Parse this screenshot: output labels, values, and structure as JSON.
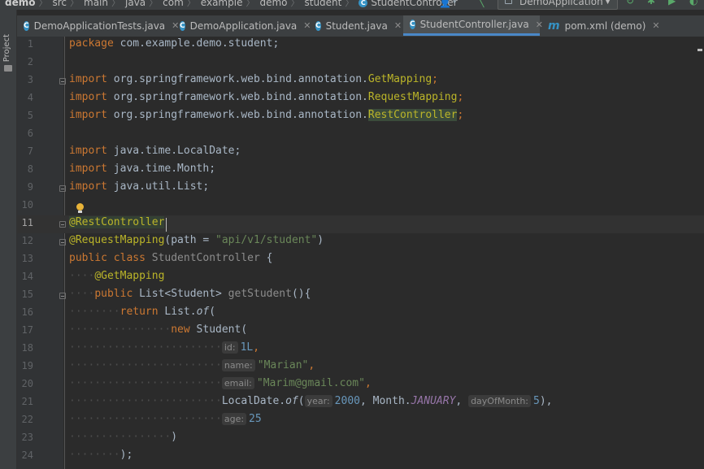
{
  "breadcrumb": {
    "items": [
      "demo",
      "src",
      "main",
      "java",
      "com",
      "example",
      "demo",
      "student",
      "StudentController"
    ]
  },
  "toolbar": {
    "run_config": "DemoApplication"
  },
  "sidebar": {
    "project_label": "Project"
  },
  "tabs": [
    {
      "label": "DemoApplicationTests.java",
      "icon": "class-c-icon"
    },
    {
      "label": "DemoApplication.java",
      "icon": "class-c-icon"
    },
    {
      "label": "Student.java",
      "icon": "class-c-icon"
    },
    {
      "label": "StudentController.java",
      "icon": "class-c-icon",
      "active": true
    },
    {
      "label": "pom.xml (demo)",
      "icon": "maven-m-icon"
    }
  ],
  "editor": {
    "current_line": 11,
    "line_numbers": [
      "1",
      "2",
      "3",
      "4",
      "5",
      "6",
      "7",
      "8",
      "9",
      "10",
      "11",
      "12",
      "13",
      "14",
      "15",
      "16",
      "17",
      "18",
      "19",
      "20",
      "21",
      "22",
      "23",
      "24"
    ],
    "lines": {
      "l1": {
        "kw": "package",
        "rest": " com.example.demo.student;"
      },
      "l3": {
        "kw": "import",
        "pkg": " org.springframework.web.bind.annotation.",
        "cls": "GetMapping",
        "end": ";"
      },
      "l4": {
        "kw": "import",
        "pkg": " org.springframework.web.bind.annotation.",
        "cls": "RequestMapping",
        "end": ";"
      },
      "l5": {
        "kw": "import",
        "pkg": " org.springframework.web.bind.annotation.",
        "cls": "RestController",
        "end": ";"
      },
      "l7": {
        "kw": "import",
        "pkg": " java.time.LocalDate;"
      },
      "l8": {
        "kw": "import",
        "pkg": " java.time.Month;"
      },
      "l9": {
        "kw": "import",
        "pkg": " java.util.List;"
      },
      "l11": {
        "ann": "@RestController"
      },
      "l12": {
        "ann": "@RequestMapping",
        "open": "(path = ",
        "str": "\"api/v1/student\"",
        "close": ")"
      },
      "l13": {
        "kw": "public class",
        "name": " StudentController",
        "brace": " {"
      },
      "l14": {
        "ann": "@GetMapping"
      },
      "l15": {
        "kw": "public",
        "type": " List<Student>",
        "name": " getStudent",
        "rest": "(){"
      },
      "l16": {
        "kw": "return",
        "rest": " List.",
        "method": "of",
        "paren": "("
      },
      "l17": {
        "kw": "new",
        "rest": " Student("
      },
      "l18": {
        "hint": "id:",
        "num": "1L",
        "end": ","
      },
      "l19": {
        "hint": "name:",
        "str": "\"Marian\"",
        "end": ","
      },
      "l20": {
        "hint": "email:",
        "str": "\"Marim@gmail.com\"",
        "end": ","
      },
      "l21": {
        "rest": "LocalDate.",
        "method": "of",
        "paren": "(",
        "hint1": "year:",
        "num1": "2000",
        "comma1": ", Month.",
        "const": "JANUARY",
        "comma2": ", ",
        "hint2": "dayOfMonth:",
        "num2": "5",
        "end": "),"
      },
      "l22": {
        "hint": "age:",
        "num": "25"
      },
      "l23": {
        "rest": ")"
      },
      "l24": {
        "rest": ");"
      }
    }
  }
}
